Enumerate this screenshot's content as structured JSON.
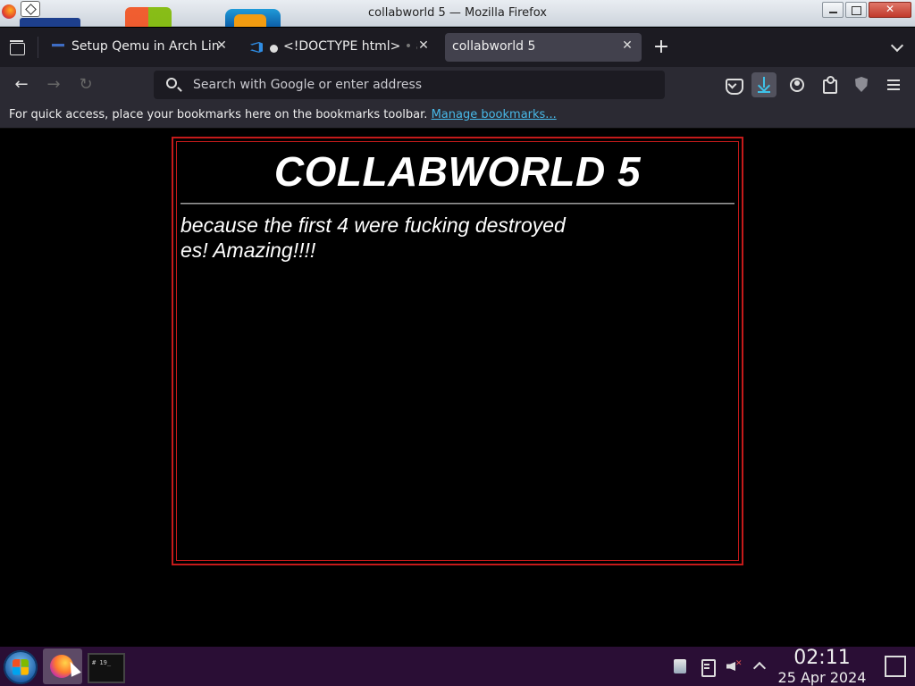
{
  "window": {
    "title": "collabworld 5 — Mozilla Firefox"
  },
  "tabs": [
    {
      "label": "Setup Qemu in Arch Linu",
      "active": false
    },
    {
      "label": "<!DOCTYPE html>",
      "suffix": " • a",
      "modified": true,
      "active": false
    },
    {
      "label": "collabworld 5",
      "active": true
    }
  ],
  "toolbar": {
    "new_tab_label": "+",
    "back_label": "←",
    "forward_label": "→",
    "reload_label": "↻",
    "url_placeholder": "Search with Google or enter address"
  },
  "bookmarks_bar": {
    "text": "For quick access, place your bookmarks here on the bookmarks toolbar.",
    "link_label": "Manage bookmarks..."
  },
  "page": {
    "heading": "COLLABWORLD 5",
    "lines": [
      "because the first 4 were fucking destroyed",
      "es! Amazing!!!!"
    ],
    "border_color": "#c41a1a"
  },
  "taskbar": {
    "clock_time": "02:11",
    "clock_date": "25 Apr 2024",
    "tray_icons": [
      "clipboard-notes-icon",
      "clipboard-icon",
      "volume-muted-icon",
      "tray-expand-icon"
    ],
    "apps": [
      "firefox",
      "terminal"
    ]
  },
  "colors": {
    "accent_link": "#48b9e8",
    "taskbar_bg": "#2a0e35",
    "tab_active_bg": "#42414d"
  }
}
